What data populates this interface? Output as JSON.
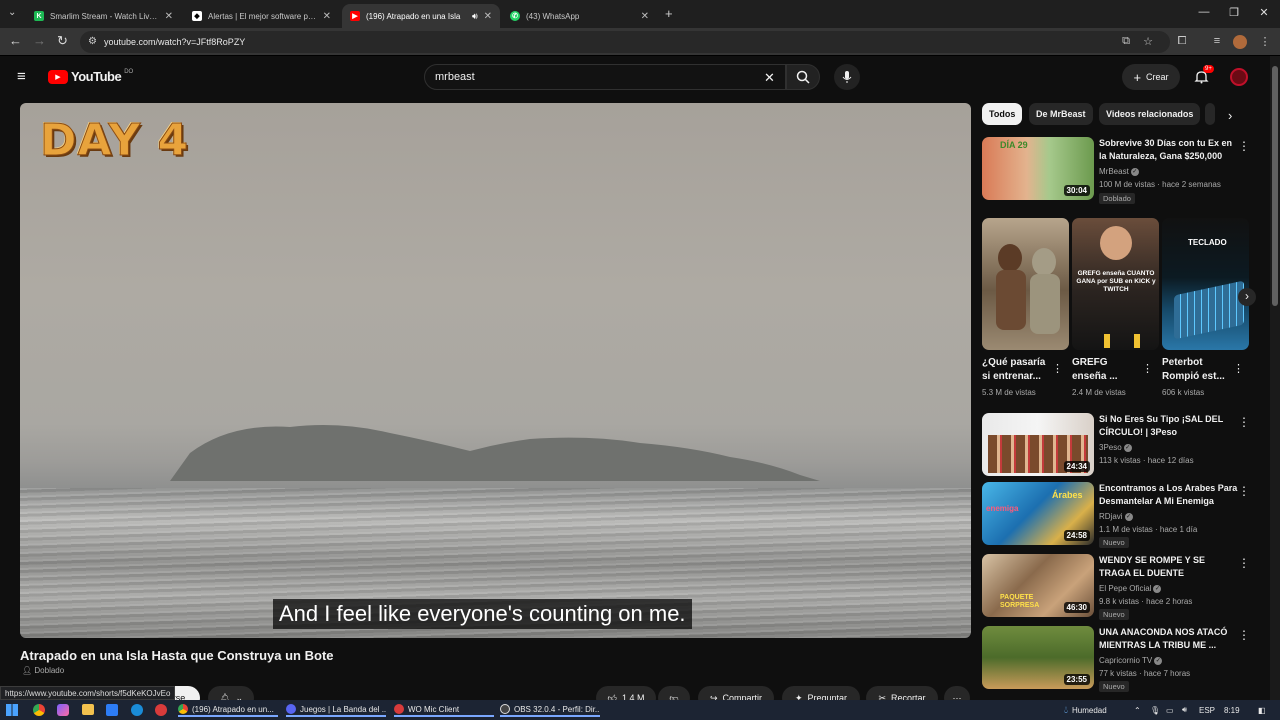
{
  "browser": {
    "tabs": [
      {
        "title": "Smarlim Stream - Watch Live o",
        "icon_color": "#1db954",
        "active": false
      },
      {
        "title": "Alertas | El mejor software para",
        "icon_color": "#ffffff",
        "active": false
      },
      {
        "title": "(196) Atrapado en una Isla",
        "icon_color": "#ff0000",
        "active": true
      },
      {
        "title": "(43) WhatsApp",
        "icon_color": "#25d366",
        "active": false
      }
    ],
    "new_tab_label": "+",
    "url": "youtube.com/watch?v=JFtf8RoPZY",
    "status_url": "https://www.youtube.com/shorts/f5dKeKOJvEo"
  },
  "youtube": {
    "logo_text": "YouTube",
    "logo_country": "DO",
    "search_value": "mrbeast",
    "create_label": "Crear",
    "notifications_count": "9+"
  },
  "player": {
    "overlay_text": "DAY 4",
    "subtitle": "And I feel like everyone's counting on me."
  },
  "video": {
    "title": "Atrapado en una Isla Hasta que Construya un Bote",
    "badge": "Doblado",
    "subscribe_partial": "irse",
    "likes": "1.4 M",
    "share_label": "Compartir",
    "ask_label": "Preguntar",
    "clip_label": "Recortar"
  },
  "chips": [
    "Todos",
    "De MrBeast",
    "Videos relacionados"
  ],
  "recommended": [
    {
      "title": "Sobrevive 30 Días con tu Ex en la Naturaleza, Gana $250,000",
      "channel": "MrBeast",
      "verified": true,
      "meta": "100 M de vistas · hace 2 semanas",
      "badge": "Doblado",
      "duration": "30:04",
      "thumb_text": "DÍA 29"
    },
    {
      "title": "Si No Eres Su Tipo ¡SAL DEL CÍRCULO! | 3Peso",
      "channel": "3Peso",
      "verified": true,
      "meta": "113 k vistas · hace 12 días",
      "badge": "",
      "duration": "24:34",
      "thumb_text": ""
    },
    {
      "title": "Encontramos a Los Arabes Para Desmantelar A Mi Enemiga",
      "channel": "RDjavi",
      "verified": true,
      "meta": "1.1 M de vistas · hace 1 día",
      "badge": "Nuevo",
      "duration": "24:58",
      "thumb_text": "Árabes"
    },
    {
      "title": "WENDY SE ROMPE Y SE TRAGA EL DUENTE",
      "channel": "El Pepe Oficial",
      "verified": true,
      "meta": "9.8 k vistas · hace 2 horas",
      "badge": "Nuevo",
      "duration": "46:30",
      "thumb_text": "PAQUETE SORPRESA"
    },
    {
      "title": "UNA ANACONDA NOS ATACÓ MIENTRAS LA TRIBU ME ...",
      "channel": "Capricornio TV",
      "verified": true,
      "meta": "77 k vistas · hace 7 horas",
      "badge": "Nuevo",
      "duration": "23:55",
      "thumb_text": ""
    }
  ],
  "shorts": [
    {
      "title": "¿Qué pasaría si entrenar...",
      "views": "5.3 M de vistas",
      "thumb_text": ""
    },
    {
      "title": "GREFG enseña ...",
      "views": "2.4 M de vistas",
      "thumb_text": "GREFG enseña CUANTO GANA por SUB en KICK y TWITCH"
    },
    {
      "title": "Peterbot Rompió est...",
      "views": "606 k vistas",
      "thumb_text": "TECLADO"
    }
  ],
  "taskbar": {
    "items": [
      "(196) Atrapado en un...",
      "Juegos | La Banda del ...",
      "WO Mic Client",
      "OBS 32.0.4 - Perfil: Dir..."
    ],
    "weather": "Humedad",
    "lang": "ESP",
    "time": "8:19"
  },
  "colors": {
    "accent": "#ff0000",
    "bg": "#0f0f0f",
    "chip": "#272727"
  }
}
